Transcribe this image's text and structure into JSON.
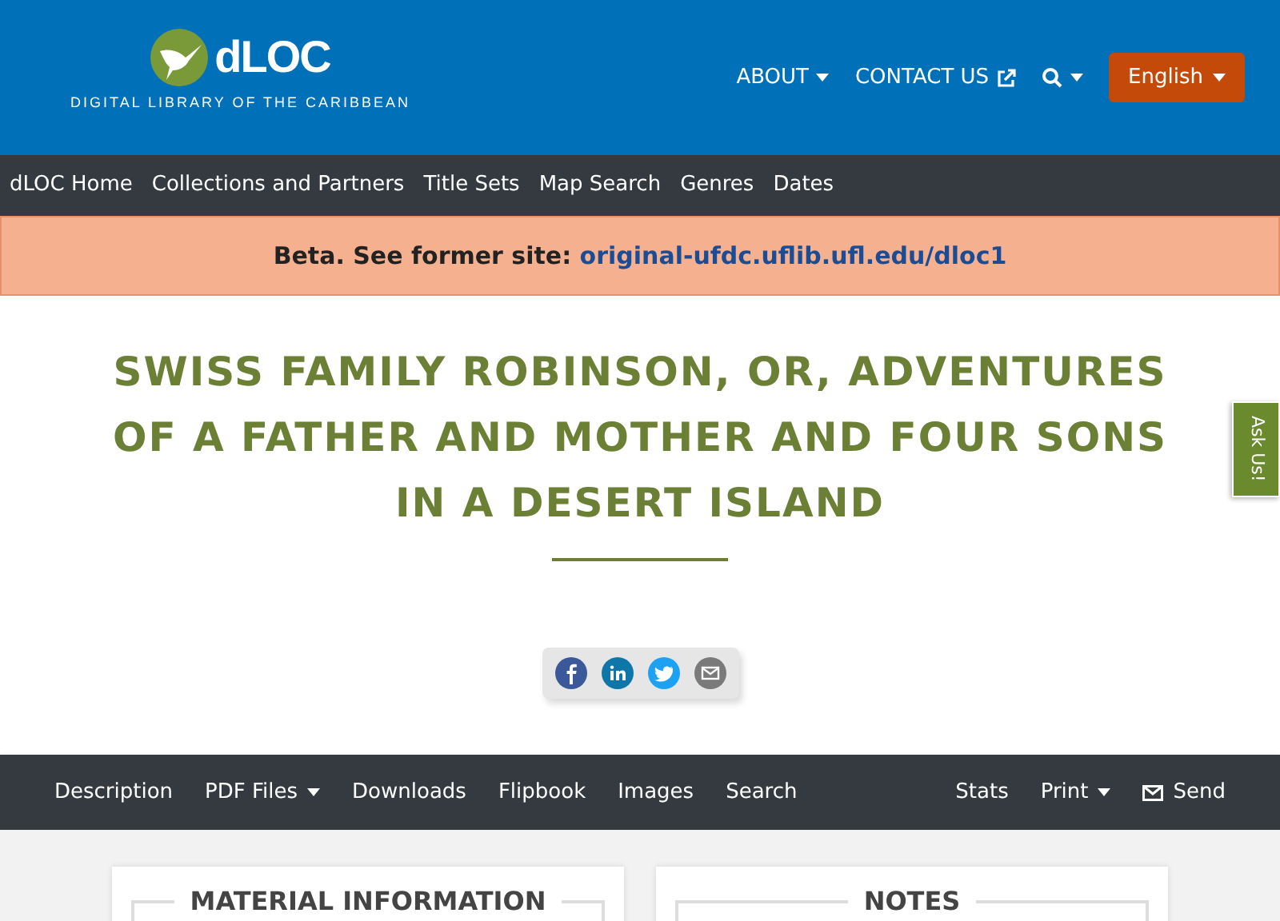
{
  "logo": {
    "name": "dLOC",
    "tagline": "DIGITAL LIBRARY OF THE CARIBBEAN"
  },
  "top_nav": [
    {
      "kind": "dropdown",
      "label": "ABOUT"
    },
    {
      "kind": "external",
      "label": "CONTACT US"
    },
    {
      "kind": "search"
    }
  ],
  "language_button": "English",
  "main_nav": [
    "dLOC Home",
    "Collections and Partners",
    "Title Sets",
    "Map Search",
    "Genres",
    "Dates"
  ],
  "banner": {
    "text": "Beta. See former site:",
    "link": "original-ufdc.uflib.ufl.edu/dloc1"
  },
  "title": "SWISS FAMILY ROBINSON, OR, ADVENTURES OF A FATHER AND MOTHER AND FOUR SONS IN A DESERT ISLAND",
  "share": [
    {
      "kind": "facebook",
      "color": "#3b5998"
    },
    {
      "kind": "linkedin",
      "color": "#0e76a8"
    },
    {
      "kind": "twitter",
      "color": "#1da1f2"
    },
    {
      "kind": "email",
      "color": "#7a7a7a"
    }
  ],
  "item_nav": {
    "left": [
      {
        "kind": "link",
        "label": "Description"
      },
      {
        "kind": "dropdown",
        "label": "PDF Files"
      },
      {
        "kind": "link",
        "label": "Downloads"
      },
      {
        "kind": "link",
        "label": "Flipbook"
      },
      {
        "kind": "link",
        "label": "Images"
      },
      {
        "kind": "link",
        "label": "Search"
      }
    ],
    "right": [
      {
        "kind": "link",
        "label": "Stats"
      },
      {
        "kind": "dropdown",
        "label": "Print"
      },
      {
        "kind": "mail",
        "label": "Send"
      }
    ]
  },
  "panels": [
    {
      "title": "MATERIAL INFORMATION"
    },
    {
      "title": "NOTES"
    }
  ],
  "ask_tab": "Ask Us!"
}
